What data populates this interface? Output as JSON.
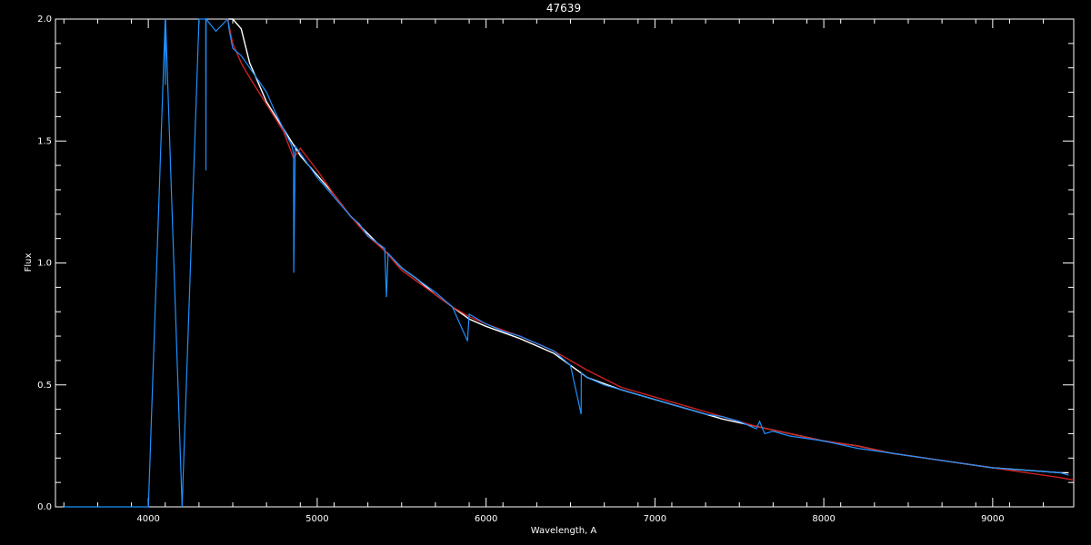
{
  "chart_data": {
    "type": "line",
    "title": "47639",
    "xlabel": "Wavelength, A",
    "ylabel": "Flux",
    "xlim": [
      3450,
      9480
    ],
    "ylim": [
      0.0,
      2.0
    ],
    "x_ticks": [
      4000,
      5000,
      6000,
      7000,
      8000,
      9000
    ],
    "x_tick_labels": [
      "4000",
      "5000",
      "6000",
      "7000",
      "8000",
      "9000"
    ],
    "y_ticks": [
      0.0,
      0.5,
      1.0,
      1.5,
      2.0
    ],
    "y_tick_labels": [
      "0.0",
      "0.5",
      "1.0",
      "1.5",
      "2.0"
    ],
    "grid": false,
    "background": "#000000",
    "axis_color": "#ffffff",
    "series": [
      {
        "color": "#ffffff",
        "x": [
          4470,
          4500,
          4550,
          4600,
          4700,
          4800,
          4900,
          5000,
          5100,
          5200,
          5300,
          5400,
          5500,
          5600,
          5700,
          5800,
          5900,
          6000,
          6200,
          6400,
          6600,
          6800,
          7000,
          7200,
          7400,
          7600,
          7800,
          8000,
          8200,
          8400,
          8600,
          8800,
          9000,
          9200,
          9400,
          9450
        ],
        "y": [
          2.0,
          2.0,
          1.96,
          1.82,
          1.66,
          1.55,
          1.44,
          1.36,
          1.28,
          1.19,
          1.12,
          1.05,
          0.98,
          0.93,
          0.87,
          0.82,
          0.77,
          0.74,
          0.69,
          0.63,
          0.53,
          0.48,
          0.44,
          0.4,
          0.36,
          0.33,
          0.3,
          0.27,
          0.25,
          0.22,
          0.2,
          0.18,
          0.16,
          0.15,
          0.14,
          0.14
        ]
      },
      {
        "color": "#cc2222",
        "x": [
          4470,
          4500,
          4550,
          4600,
          4700,
          4800,
          4860,
          4900,
          5000,
          5100,
          5200,
          5300,
          5400,
          5500,
          5600,
          5700,
          5800,
          5900,
          6000,
          6200,
          6400,
          6600,
          6800,
          7000,
          7200,
          7400,
          7600,
          7800,
          8000,
          8200,
          8400,
          8600,
          8800,
          9000,
          9200,
          9400,
          9480
        ],
        "y": [
          2.0,
          1.9,
          1.82,
          1.76,
          1.65,
          1.54,
          1.43,
          1.47,
          1.38,
          1.28,
          1.19,
          1.11,
          1.05,
          0.97,
          0.92,
          0.87,
          0.82,
          0.78,
          0.75,
          0.7,
          0.64,
          0.56,
          0.49,
          0.45,
          0.41,
          0.37,
          0.33,
          0.3,
          0.27,
          0.25,
          0.22,
          0.2,
          0.18,
          0.16,
          0.14,
          0.12,
          0.11
        ]
      },
      {
        "color": "#1e90ff",
        "x": [
          3500,
          3800,
          4000,
          4100,
          4101,
          4102,
          4200,
          4300,
          4340,
          4341,
          4342,
          4400,
          4470,
          4480,
          4500,
          4550,
          4600,
          4650,
          4700,
          4750,
          4800,
          4850,
          4860,
          4861,
          4870,
          4900,
          4950,
          5000,
          5100,
          5200,
          5250,
          5300,
          5400,
          5410,
          5420,
          5500,
          5600,
          5700,
          5800,
          5890,
          5900,
          6000,
          6100,
          6200,
          6300,
          6400,
          6500,
          6563,
          6564,
          6600,
          6700,
          6800,
          6900,
          7000,
          7100,
          7200,
          7300,
          7400,
          7500,
          7600,
          7620,
          7650,
          7700,
          7800,
          8000,
          8200,
          8400,
          8600,
          8800,
          9000,
          9200,
          9400,
          9450
        ],
        "y": [
          0.0,
          0.0,
          0.0,
          2.0,
          1.73,
          2.0,
          0.0,
          2.0,
          2.0,
          1.38,
          2.0,
          1.95,
          2.0,
          1.95,
          1.88,
          1.85,
          1.8,
          1.75,
          1.7,
          1.62,
          1.55,
          1.48,
          1.45,
          0.96,
          1.48,
          1.45,
          1.4,
          1.35,
          1.27,
          1.19,
          1.16,
          1.11,
          1.06,
          0.86,
          1.04,
          0.98,
          0.93,
          0.88,
          0.82,
          0.68,
          0.79,
          0.75,
          0.72,
          0.7,
          0.67,
          0.64,
          0.58,
          0.38,
          0.55,
          0.53,
          0.5,
          0.48,
          0.46,
          0.44,
          0.42,
          0.4,
          0.38,
          0.37,
          0.35,
          0.32,
          0.35,
          0.3,
          0.31,
          0.29,
          0.27,
          0.24,
          0.22,
          0.2,
          0.18,
          0.16,
          0.15,
          0.14,
          0.13
        ]
      }
    ]
  }
}
